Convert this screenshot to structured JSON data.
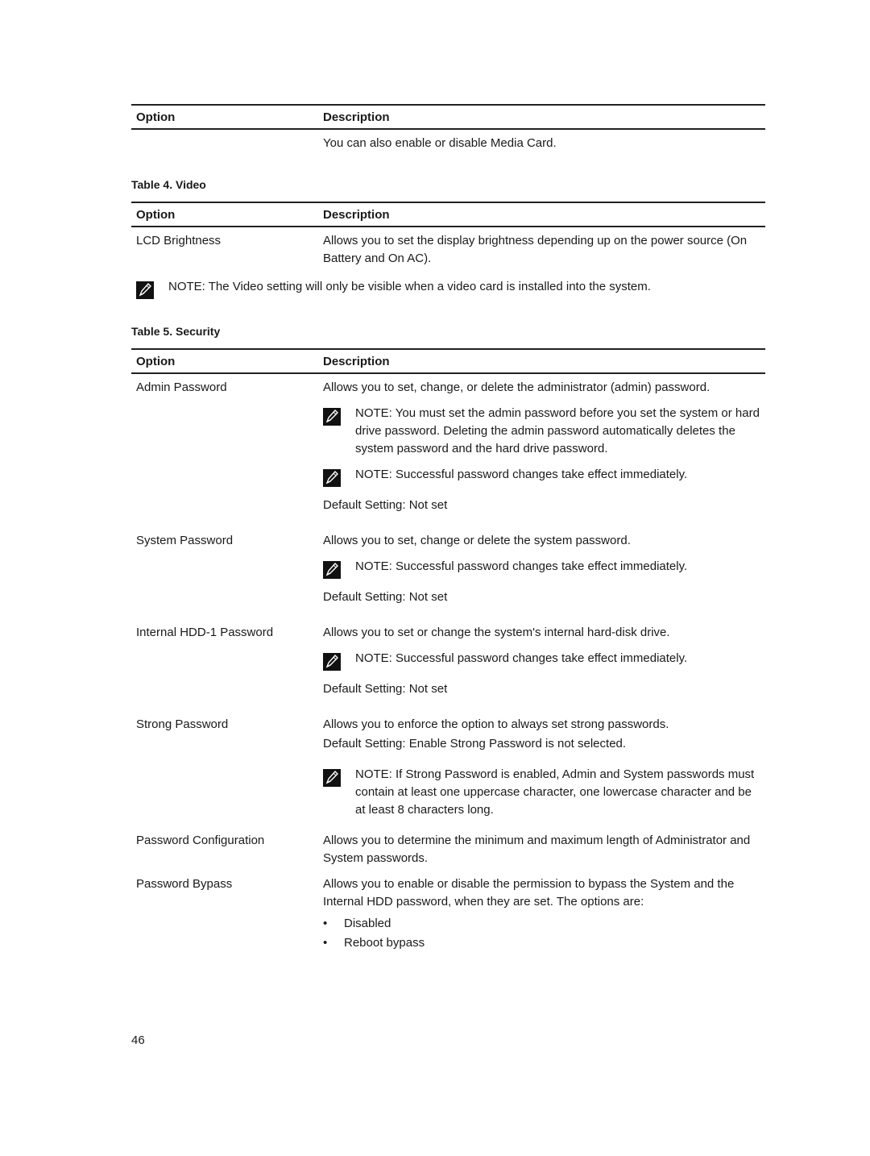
{
  "table_top": {
    "headers": [
      "Option",
      "Description"
    ],
    "rows": [
      {
        "option": "",
        "description": "You can also enable or disable Media Card."
      }
    ]
  },
  "table4": {
    "caption": "Table 4. Video",
    "headers": [
      "Option",
      "Description"
    ],
    "rows": [
      {
        "option": "LCD Brightness",
        "description": "Allows you to set the display brightness depending up on the power source (On Battery and On AC)."
      }
    ],
    "note": {
      "label": "NOTE:",
      "text": " The Video setting will only be visible when a video card is installed into the system."
    }
  },
  "table5": {
    "caption": "Table 5. Security",
    "headers": [
      "Option",
      "Description"
    ],
    "rows": [
      {
        "option": "Admin Password",
        "description": "Allows you to set, change, or delete the administrator (admin) password.",
        "notes": [
          {
            "label": "NOTE:",
            "text": " You must set the admin password before you set the system or hard drive password. Deleting the admin password automatically deletes the system password and the hard drive password."
          },
          {
            "label": "NOTE:",
            "text": " Successful password changes take effect immediately."
          }
        ],
        "default": "Default Setting: Not set"
      },
      {
        "option": "System Password",
        "description": "Allows you to set, change or delete the system password.",
        "notes": [
          {
            "label": "NOTE:",
            "text": " Successful password changes take effect immediately."
          }
        ],
        "default": "Default Setting: Not set"
      },
      {
        "option": "Internal HDD-1 Password",
        "description": "Allows you to set or change the system's internal hard-disk drive.",
        "notes": [
          {
            "label": "NOTE:",
            "text": " Successful password changes take effect immediately."
          }
        ],
        "default": "Default Setting: Not set"
      },
      {
        "option": "Strong Password",
        "description": "Allows you to enforce the option to always set strong passwords.",
        "default": "Default Setting: Enable Strong Password is not selected.",
        "notes": [
          {
            "label": "NOTE:",
            "text": " If Strong Password is enabled, Admin and System passwords must contain at least one uppercase character, one lowercase character and be at least 8 characters long."
          }
        ]
      },
      {
        "option": "Password Configuration",
        "description": "Allows you to determine the minimum and maximum length of Administrator and System passwords."
      },
      {
        "option": "Password Bypass",
        "description": "Allows you to enable or disable the permission to bypass the System and the Internal HDD password, when they are set. The options are:",
        "options": [
          "Disabled",
          "Reboot bypass"
        ]
      }
    ]
  },
  "page_number": "46"
}
